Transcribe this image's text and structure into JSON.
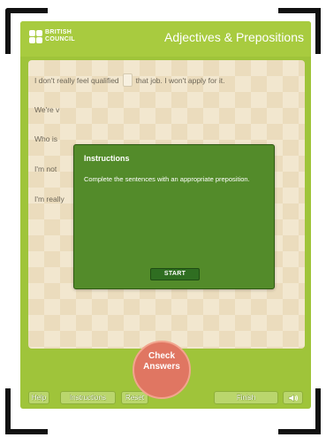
{
  "header": {
    "logo_line1": "BRITISH",
    "logo_line2": "COUNCIL",
    "title": "Adjectives & Prepositions"
  },
  "exercise": {
    "sentences": [
      {
        "before": "I don't really feel qualified",
        "after": "that job. I won't apply for it."
      },
      {
        "before": "We're v"
      },
      {
        "before": "Who is"
      },
      {
        "before": "I'm not"
      },
      {
        "before": "I'm really"
      }
    ]
  },
  "modal": {
    "title": "Instructions",
    "text": "Complete the sentences with an appropriate preposition.",
    "start_label": "START"
  },
  "toolbar": {
    "help": "Help",
    "instructions": "Instructions",
    "reset": "Reset",
    "check_line1": "Check",
    "check_line2": "Answers",
    "finish": "Finish",
    "sound_icon": "speaker-icon"
  },
  "colors": {
    "frame_green": "#9fc43a",
    "modal_green": "#538b2a",
    "check_button": "#e07662"
  }
}
